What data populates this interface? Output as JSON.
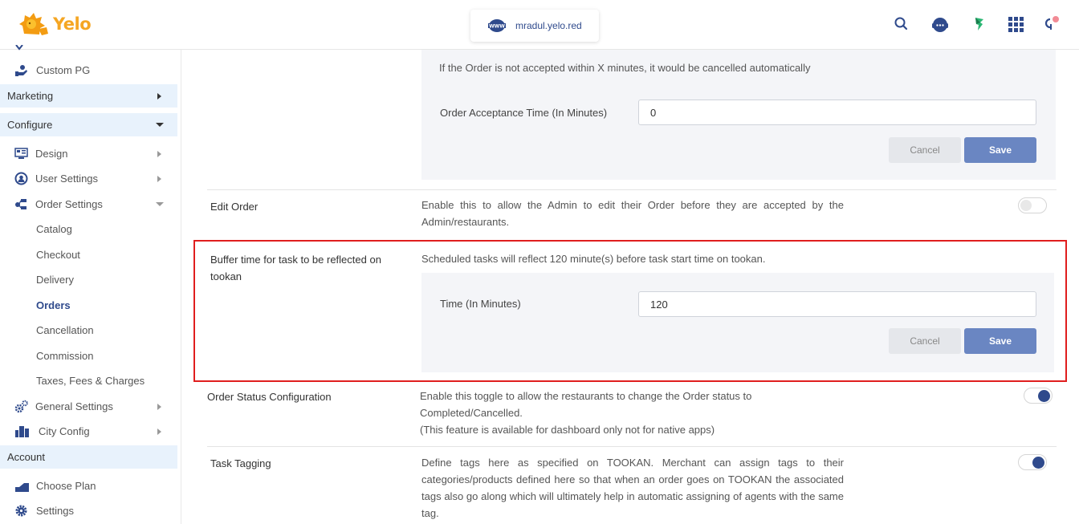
{
  "header": {
    "brand": "Yelo",
    "domain": "mradul.yelo.red",
    "icons": [
      "search-icon",
      "support-chat-icon",
      "tookan-icon",
      "apps-grid-icon",
      "profile-notification-icon"
    ]
  },
  "sidebar": {
    "partial_item": "Custom PG",
    "sections": {
      "marketing": "Marketing",
      "configure": "Configure",
      "account": "Account"
    },
    "configure_items": {
      "design": "Design",
      "user_settings": "User Settings",
      "order_settings": "Order Settings",
      "general_settings": "General Settings",
      "city_config": "City Config"
    },
    "order_settings_sub": [
      "Catalog",
      "Checkout",
      "Delivery",
      "Orders",
      "Cancellation",
      "Commission",
      "Taxes, Fees & Charges"
    ],
    "active_sub": "Orders",
    "account_items": {
      "choose_plan": "Choose Plan",
      "settings": "Settings"
    }
  },
  "main": {
    "order_acceptance": {
      "description": "If the Order is not accepted within X minutes, it would be cancelled automatically",
      "field_label": "Order Acceptance Time (In Minutes)",
      "field_value": "0",
      "cancel_label": "Cancel",
      "save_label": "Save"
    },
    "edit_order": {
      "title": "Edit Order",
      "description": "Enable this to allow the Admin to edit their Order before they are accepted by the Admin/restaurants.",
      "enabled": false
    },
    "buffer_time": {
      "title": "Buffer time for task to be reflected on tookan",
      "description": "Scheduled tasks will reflect 120 minute(s) before task start time on tookan.",
      "field_label": "Time (In Minutes)",
      "field_value": "120",
      "cancel_label": "Cancel",
      "save_label": "Save"
    },
    "order_status_config": {
      "title": "Order Status Configuration",
      "description_line1": "Enable this toggle to allow the restaurants to change the Order status to",
      "description_line2": "Completed/Cancelled.",
      "description_line3": "(This feature is available for dashboard only not for native apps)",
      "enabled": true
    },
    "task_tagging": {
      "title": "Task Tagging",
      "description": "Define tags here as specified on TOOKAN. Merchant can assign tags to their categories/products defined here so that when an order goes on TOOKAN the associated tags also go along which will ultimately help in automatic assigning of agents with the same tag.",
      "enabled": true
    }
  },
  "colors": {
    "brand": "#f5a623",
    "primary": "#2f4a8c",
    "save_button": "#6a86c2",
    "highlight": "#e01e1e",
    "section_bg": "#e8f2fc"
  }
}
